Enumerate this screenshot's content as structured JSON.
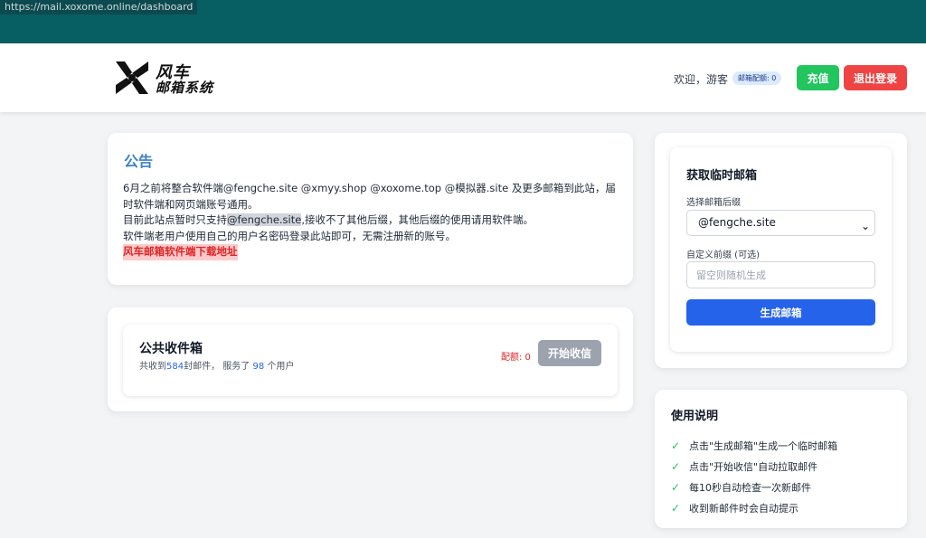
{
  "browser": {
    "url": "https://mail.xoxome.online/dashboard"
  },
  "logo": {
    "line1": "风车",
    "line2": "邮箱系统"
  },
  "header": {
    "welcome": "欢迎，游客",
    "quota_badge": "邮箱配额: 0",
    "recharge_label": "充值",
    "logout_label": "退出登录"
  },
  "notice": {
    "title": "公告",
    "line1": "6月之前将整合软件端@fengche.site @xmyy.shop @xoxome.top @模拟器.site 及更多邮箱到此站，届时软件端和网页端账号通用。",
    "line2_pre": "目前此站点暂时只支持",
    "line2_hl": "@fengche.site",
    "line2_post": ",接收不了其他后缀，其他后缀的使用请用软件端。",
    "line3": "软件端老用户使用自己的用户名密码登录此站即可，无需注册新的账号。",
    "download_link": "风车邮箱软件端下载地址"
  },
  "inbox": {
    "title": "公共收件箱",
    "stats_pre": "共收到",
    "mail_count": "584",
    "stats_mid": "封邮件， 服务了 ",
    "user_count": "98",
    "stats_post": " 个用户",
    "quota": "配额: 0",
    "start_label": "开始收信"
  },
  "generator": {
    "title": "获取临时邮箱",
    "suffix_label": "选择邮箱后缀",
    "suffix_selected": "@fengche.site",
    "prefix_label": "自定义前缀 (可选)",
    "prefix_value": "",
    "prefix_placeholder": "留空则随机生成",
    "generate_label": "生成邮箱"
  },
  "guide": {
    "title": "使用说明",
    "items": [
      "点击\"生成邮箱\"生成一个临时邮箱",
      "点击\"开始收信\"自动拉取邮件",
      "每10秒自动检查一次新邮件",
      "收到新邮件时会自动提示"
    ]
  },
  "colors": {
    "browser_bar": "#075e63",
    "accent_blue": "#2563eb",
    "recharge_green": "#22c55e",
    "logout_red": "#ef4444",
    "notice_title": "#3b82c4",
    "check_green": "#22c55e"
  }
}
